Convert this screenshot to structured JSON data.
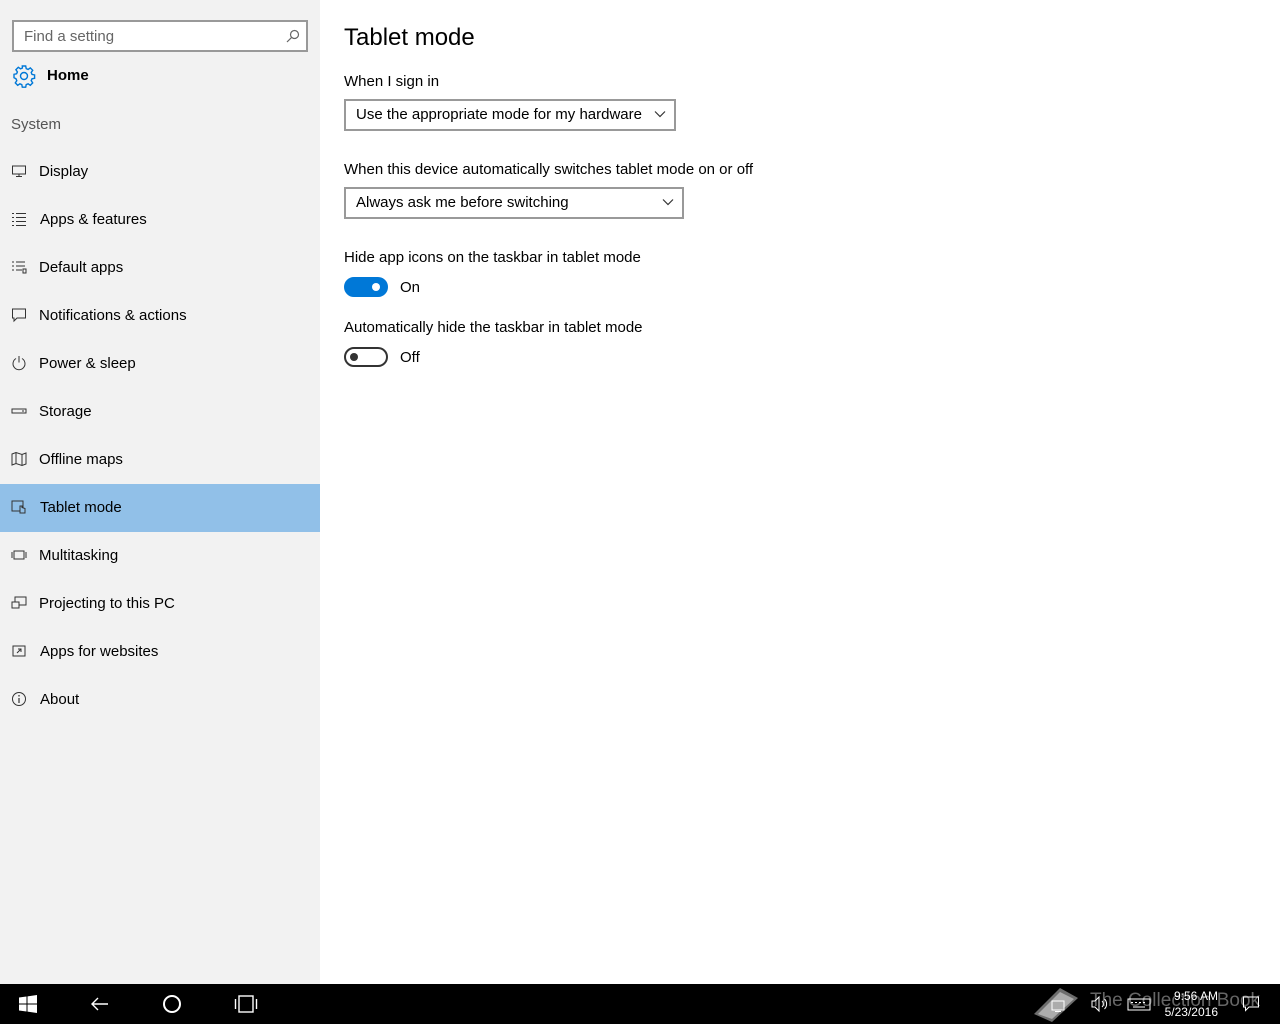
{
  "sidebar": {
    "search_placeholder": "Find a setting",
    "home_label": "Home",
    "section_label": "System",
    "items": [
      {
        "label": "Display",
        "icon": "display-icon"
      },
      {
        "label": "Apps & features",
        "icon": "list-icon"
      },
      {
        "label": "Default apps",
        "icon": "default-apps-icon"
      },
      {
        "label": "Notifications & actions",
        "icon": "notification-icon"
      },
      {
        "label": "Power & sleep",
        "icon": "power-icon"
      },
      {
        "label": "Storage",
        "icon": "storage-icon"
      },
      {
        "label": "Offline maps",
        "icon": "map-icon"
      },
      {
        "label": "Tablet mode",
        "icon": "tablet-mode-icon",
        "active": true
      },
      {
        "label": "Multitasking",
        "icon": "multitasking-icon"
      },
      {
        "label": "Projecting to this PC",
        "icon": "projecting-icon"
      },
      {
        "label": "Apps for websites",
        "icon": "apps-websites-icon"
      },
      {
        "label": "About",
        "icon": "info-icon"
      }
    ]
  },
  "main": {
    "title": "Tablet mode",
    "sign_in": {
      "label": "When I sign in",
      "selected": "Use the appropriate mode for my hardware"
    },
    "auto_switch": {
      "label": "When this device automatically switches tablet mode on or off",
      "selected": "Always ask me before switching"
    },
    "hide_icons": {
      "label": "Hide app icons on the taskbar in tablet mode",
      "state": "On"
    },
    "hide_taskbar": {
      "label": "Automatically hide the taskbar in tablet mode",
      "state": "Off"
    }
  },
  "taskbar": {
    "time": "9:56 AM",
    "date": "5/23/2016",
    "watermark": "The Collection Book"
  },
  "colors": {
    "accent": "#0078d7",
    "active_nav": "#91c0e8",
    "sidebar_bg": "#f2f2f2",
    "taskbar_bg": "#000000"
  }
}
